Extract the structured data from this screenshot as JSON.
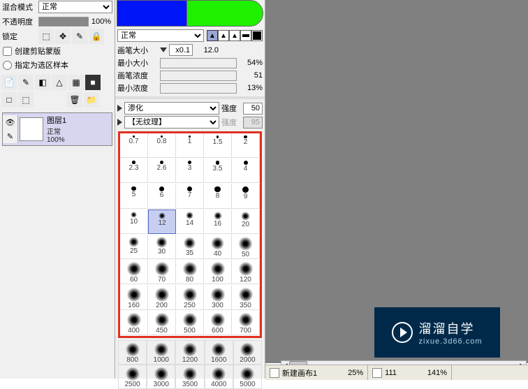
{
  "left_panel": {
    "blend_label": "混合模式",
    "blend_value": "正常",
    "opacity_label": "不透明度",
    "opacity_value": "100%",
    "lock_label": "锁定",
    "check_clipmask": "创建剪贴蒙版",
    "check_selectsample": "指定为选区样本"
  },
  "layer": {
    "name": "图层1",
    "mode": "正常",
    "opacity": "100%"
  },
  "right_panel": {
    "blend_value": "正常",
    "brush_size_label": "画笔大小",
    "brush_size_mult": "x0.1",
    "brush_size_value": "12.0",
    "min_size_label": "最小大小",
    "min_size_value": "54%",
    "density_label": "画笔浓度",
    "density_value": "51",
    "min_density_label": "最小浓度",
    "min_density_value": "13%",
    "bleed_label": "渗化",
    "strength_label": "强度",
    "strength_value": "50",
    "texture_label": "【无纹理】",
    "texture_strength_label": "强度",
    "texture_strength_value": "95"
  },
  "brush_sizes": [
    "0.7",
    "0.8",
    "1",
    "1.5",
    "2",
    "2.3",
    "2.6",
    "3",
    "3.5",
    "4",
    "5",
    "6",
    "7",
    "8",
    "9",
    "10",
    "12",
    "14",
    "16",
    "20",
    "25",
    "30",
    "35",
    "40",
    "50",
    "60",
    "70",
    "80",
    "100",
    "120",
    "160",
    "200",
    "250",
    "300",
    "350",
    "400",
    "450",
    "500",
    "600",
    "700"
  ],
  "brush_sizes_below_grid": [
    "800",
    "1000",
    "1200",
    "1600",
    "2000",
    "2500",
    "3000",
    "3500",
    "4000",
    "5000"
  ],
  "brush_selected_index": 16,
  "bottom": {
    "tab1": "新建画布1",
    "tab1_pct": "25%",
    "tab2": "111",
    "tab2_pct": "141%"
  },
  "logo": {
    "title": "溜溜自学",
    "url": "zixue.3d66.com"
  },
  "icons": {
    "lock_transparent": "⬚",
    "lock_move": "✥",
    "lock_edit": "✎",
    "lock_all": "🔒",
    "new_layer": "📄",
    "new_folder": "📁",
    "mask": "◧",
    "fx": "fx",
    "trash": "🗑",
    "eye": "👁",
    "pencil": "✎"
  }
}
